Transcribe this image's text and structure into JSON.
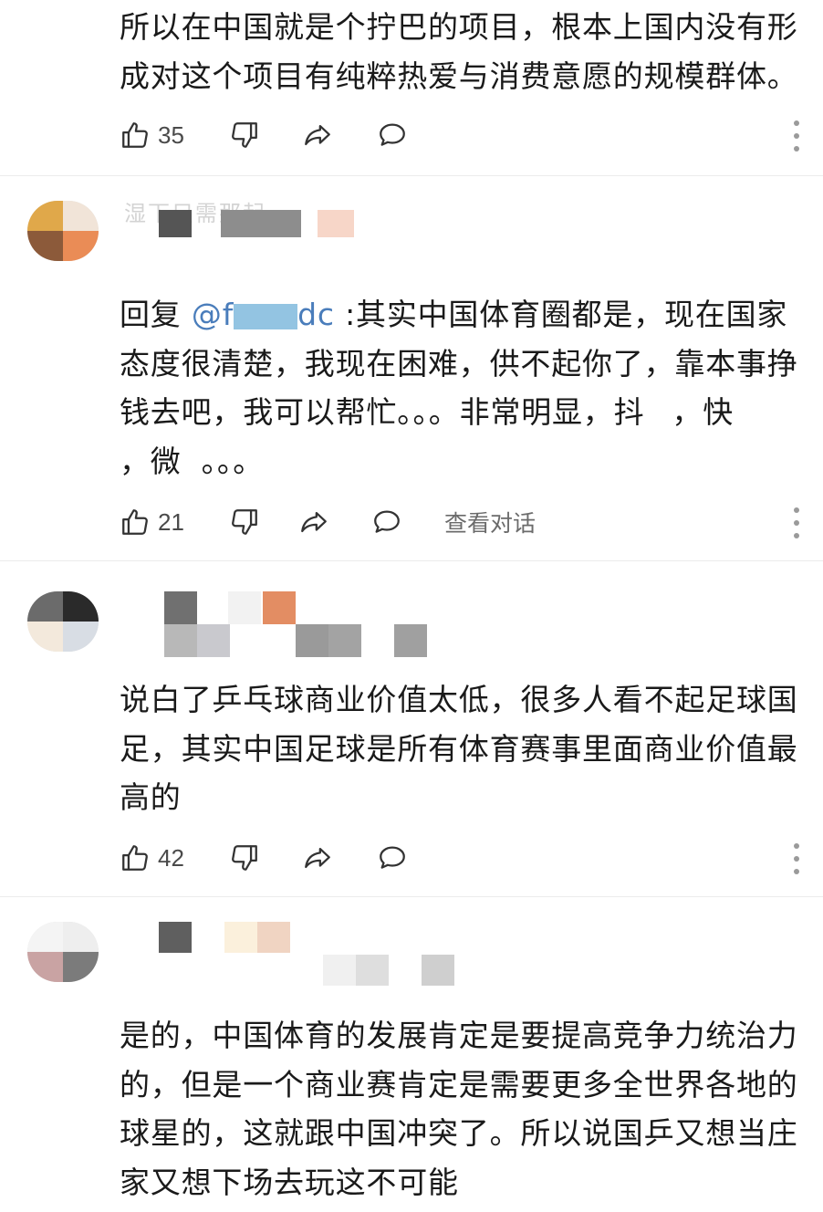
{
  "comments": [
    {
      "content_lines": [
        "所以在中国就是个拧巴的项目，根本上国内没有形",
        "成对这个项目有纯粹热爱与消费意愿的规模群体。"
      ],
      "likes": "35"
    },
    {
      "author": "湿下只需那起",
      "reply_prefix": "回复 ",
      "mention_start": "@f",
      "mention_end": "dc",
      "content_first": " :其实中国体育圈都是，现在国家",
      "content_lines": [
        "态度很清楚，我现在困难，供不起你了，靠本事挣",
        "钱去吧，我可以帮忙。。。非常明显，抖",
        "，微"
      ],
      "content_tail": "。。。",
      "content_line3_tail": "，快",
      "likes": "21",
      "view_conversation": "查看对话"
    },
    {
      "content_lines": [
        "说白了乒乓球商业价值太低，很多人看不起足球国",
        "足，其实中国足球是所有体育赛事里面商业价值最",
        "高的"
      ],
      "likes": "42"
    },
    {
      "content_lines": [
        "是的，中国体育的发展肯定是要提高竞争力统治力",
        "的，但是一个商业赛肯定是需要更多全世界各地的",
        "球星的，这就跟中国冲突了。所以说国乒又想当庄",
        "家又想下场去玩这不可能"
      ]
    }
  ],
  "icons": {
    "like": "thumbs-up-icon",
    "dislike": "thumbs-down-icon",
    "share": "share-arrow-icon",
    "reply": "chat-bubble-icon",
    "more": "more-vertical-icon"
  },
  "colors": {
    "text": "#1a1a1a",
    "secondary": "#6b6b6b",
    "mention": "#4a7dbb",
    "divider": "#ececec"
  }
}
